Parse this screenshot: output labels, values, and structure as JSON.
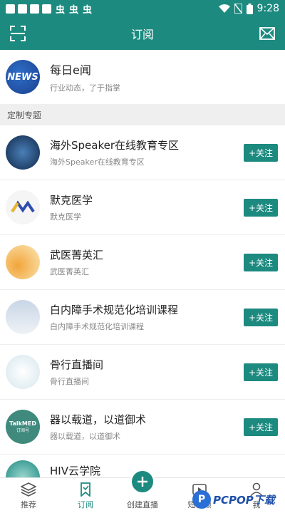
{
  "status_bar": {
    "time": "9:28",
    "bug_glyph": "虫",
    "wifi_icon": "wifi-icon",
    "battery_icon": "battery-icon"
  },
  "header": {
    "title": "订阅",
    "left_icon": "scan-icon",
    "right_icon": "mail-icon"
  },
  "daily": {
    "logo_text": "NEWS",
    "title": "每日e闻",
    "subtitle": "行业动态，了于指掌"
  },
  "section": {
    "label": "定制专题"
  },
  "follow_label": "+关注",
  "items": [
    {
      "name": "海外Speaker在线教育专区",
      "sub": "海外Speaker在线教育专区",
      "color": "#1a3b66"
    },
    {
      "name": "默克医学",
      "sub": "默克医学",
      "color": "#ffffff"
    },
    {
      "name": "武医菁英汇",
      "sub": "武医菁英汇",
      "color": "#f3c04a"
    },
    {
      "name": "白内障手术规范化培训课程",
      "sub": "白内障手术规范化培训课程",
      "color": "#dfe6ef"
    },
    {
      "name": "骨行直播间",
      "sub": "骨行直播间",
      "color": "#e6f0f5"
    },
    {
      "name": "器以载道，以道御术",
      "sub": "器以载道，以道御术",
      "color": "#3f8a7d",
      "avatar_text": "TalkMED",
      "avatar_sub": "订阅号"
    },
    {
      "name": "HIV云学院",
      "sub": "",
      "color": "#1d8a80"
    }
  ],
  "bottom_tabs": [
    {
      "label": "推荐",
      "icon": "layers-icon"
    },
    {
      "label": "订阅",
      "icon": "bookmark-icon"
    },
    {
      "label": "创建直播",
      "icon": "plus-icon"
    },
    {
      "label": "短视频",
      "icon": "video-icon"
    },
    {
      "label": "我",
      "icon": "user-icon"
    }
  ],
  "watermark": {
    "logo": "P",
    "text": "PCPOP下载"
  },
  "colors": {
    "primary": "#1d8a80"
  }
}
